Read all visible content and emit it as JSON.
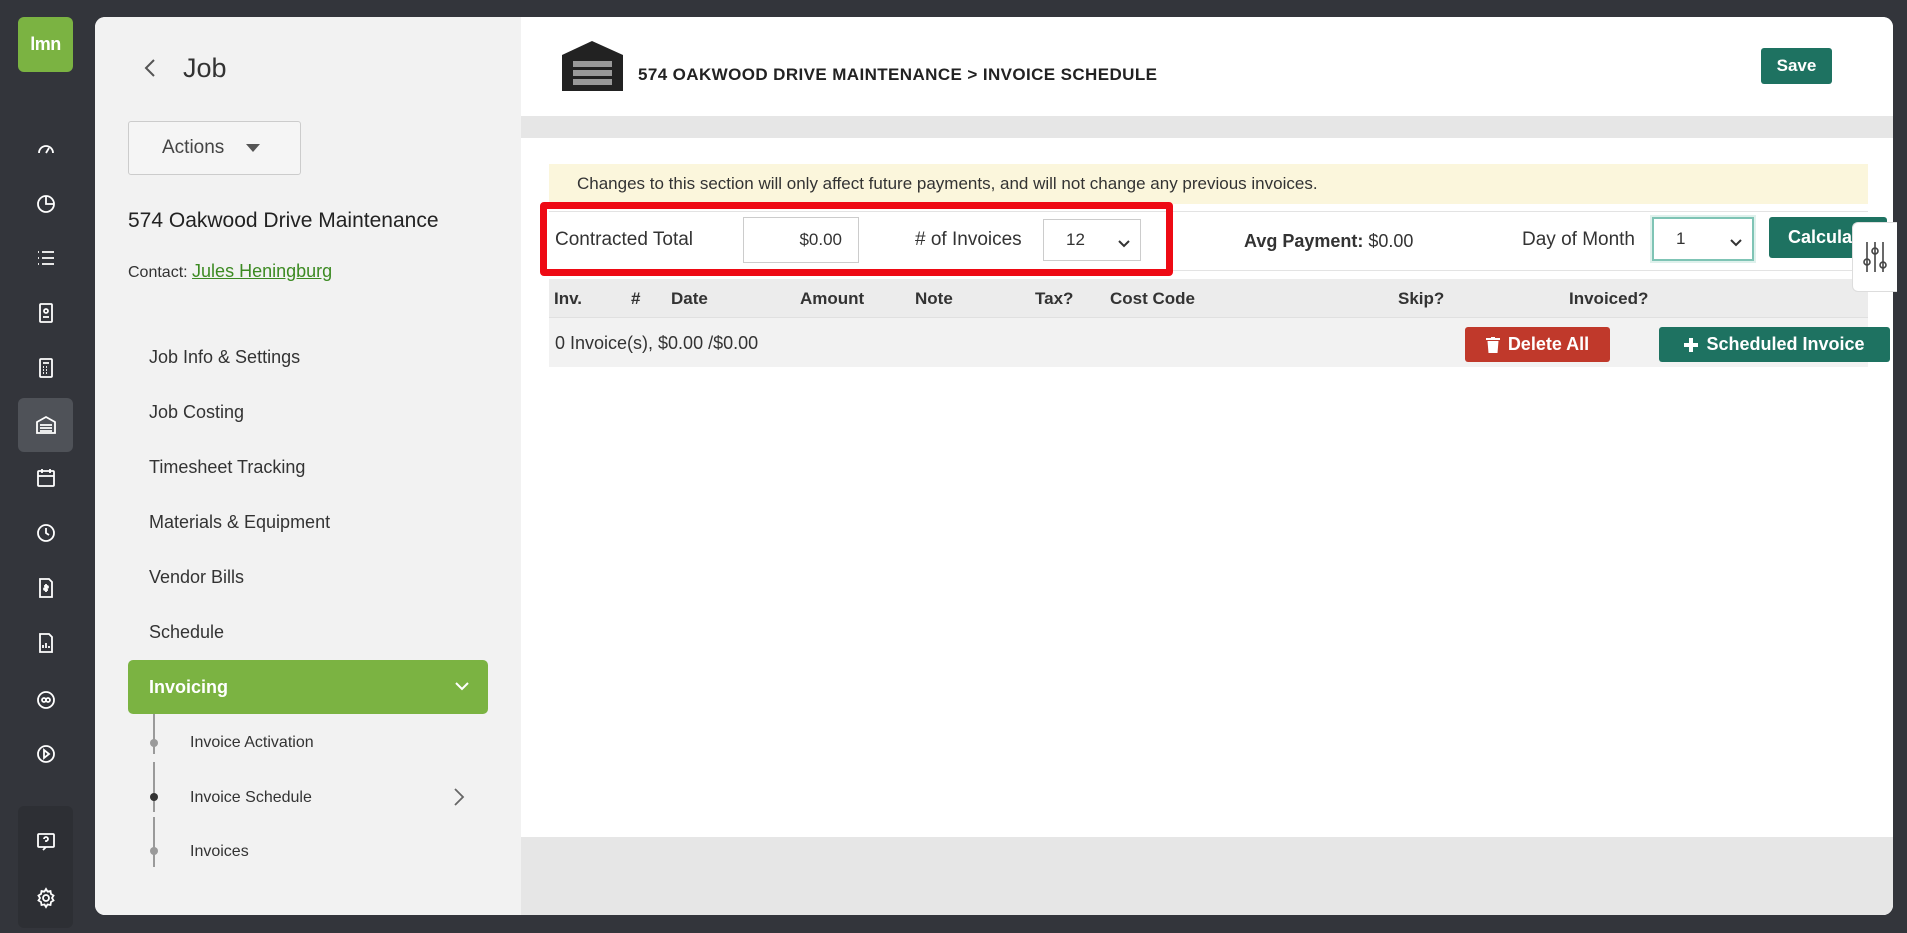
{
  "brand": {
    "logo_text": "lmn",
    "accent": "#7bb342",
    "primary": "#1e7261",
    "danger": "#c0392b"
  },
  "rail": {
    "icons": [
      "gauge-icon",
      "pie-chart-icon",
      "list-icon",
      "contacts-icon",
      "calculator-icon",
      "jobs-icon",
      "calendar-icon",
      "clock-icon",
      "invoice-icon",
      "report-icon",
      "quickbooks-icon",
      "play-icon",
      "help-icon",
      "settings-icon"
    ]
  },
  "left": {
    "title": "Job",
    "actions_label": "Actions",
    "job_name": "574 Oakwood Drive Maintenance",
    "contact_label": "Contact:",
    "contact_name": "Jules Heningburg",
    "nav": [
      "Job Info & Settings",
      "Job Costing",
      "Timesheet Tracking",
      "Materials & Equipment",
      "Vendor Bills",
      "Schedule"
    ],
    "active_nav": "Invoicing",
    "sub_nav": [
      "Invoice Activation",
      "Invoice Schedule",
      "Invoices"
    ]
  },
  "header": {
    "title": "574 OAKWOOD DRIVE MAINTENANCE > INVOICE SCHEDULE",
    "save_label": "Save"
  },
  "notice": "Changes to this section will only affect future payments, and will not change any previous invoices.",
  "form": {
    "contracted_total_label": "Contracted Total",
    "contracted_total_value": "$0.00",
    "num_invoices_label": "# of Invoices",
    "num_invoices_value": "12",
    "avg_payment_label": "Avg Payment:",
    "avg_payment_value": "$0.00",
    "day_of_month_label": "Day of Month",
    "day_of_month_value": "1",
    "calculate_label": "Calculate"
  },
  "table": {
    "columns": [
      "Inv.",
      "#",
      "Date",
      "Amount",
      "Note",
      "Tax?",
      "Cost Code",
      "Skip?",
      "Invoiced?"
    ],
    "summary": "0 Invoice(s), $0.00 /$0.00",
    "delete_all_label": "Delete All",
    "scheduled_invoice_label": "Scheduled Invoice"
  }
}
